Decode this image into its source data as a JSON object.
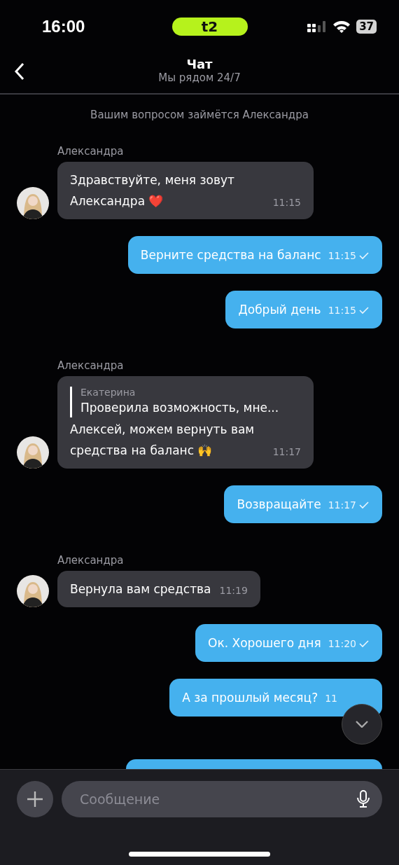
{
  "status_bar": {
    "time": "16:00",
    "carrier": "t2",
    "battery": "37"
  },
  "header": {
    "title": "Чат",
    "subtitle": "Мы рядом 24/7"
  },
  "messages": [
    {
      "kind": "notice",
      "text": "Вашим вопросом займётся Александра"
    },
    {
      "kind": "incoming",
      "sender": "Александра",
      "text": "Здравствуйте, меня зовут Александра ❤️",
      "time": "11:15"
    },
    {
      "kind": "outgoing",
      "text": "Верните средства на баланс",
      "time": "11:15",
      "sent": true
    },
    {
      "kind": "outgoing",
      "text": "Добрый день",
      "time": "11:15",
      "sent": true
    },
    {
      "kind": "incoming",
      "sender": "Александра",
      "quote": {
        "author": "Екатерина",
        "text": "Проверила возможность, мне..."
      },
      "text": "Алексей, можем вернуть вам средства на баланс 🙌",
      "time": "11:17"
    },
    {
      "kind": "outgoing",
      "text": "Возвращайте",
      "time": "11:17",
      "sent": true
    },
    {
      "kind": "incoming",
      "sender": "Александра",
      "text": "Вернула вам средства",
      "time": "11:19"
    },
    {
      "kind": "outgoing",
      "text": "Ок. Хорошего дня",
      "time": "11:20",
      "sent": true
    },
    {
      "kind": "outgoing",
      "text": "А за прошлый месяц?",
      "time": "11",
      "sent": false
    },
    {
      "kind": "partial"
    }
  ],
  "composer": {
    "placeholder": "Сообщение"
  }
}
